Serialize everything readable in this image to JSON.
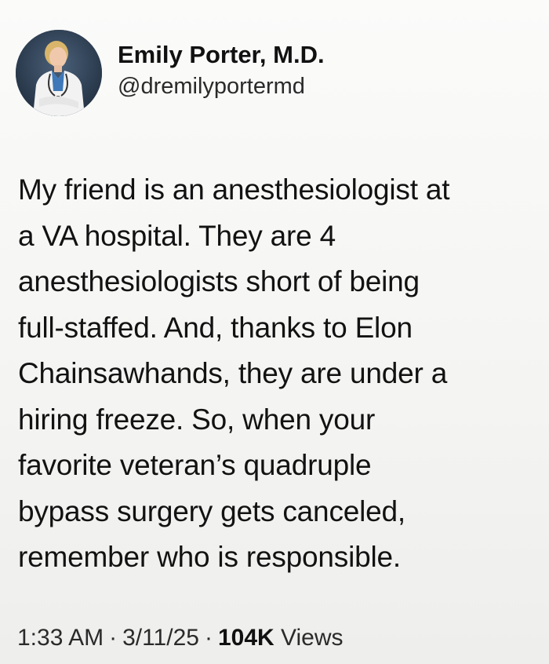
{
  "author": {
    "display_name": "Emily Porter, M.D.",
    "handle": "@dremilyportermd"
  },
  "tweet": {
    "text": "My friend is an anesthesiologist at\na VA hospital. They are 4\nanesthesiologists short of being\nfull-staffed. And, thanks to Elon\nChainsawhands, they are under a\nhiring freeze. So, when your\nfavorite veteran’s quadruple\nbypass surgery gets canceled,\nremember who is responsible."
  },
  "meta": {
    "time": "1:33 AM",
    "separator": "·",
    "date": "3/11/25",
    "views_count": "104K",
    "views_label": "Views"
  },
  "colors": {
    "background": "#f4f4f2",
    "text": "#121212",
    "avatar_bg": "#2c3e55",
    "coat": "#f2f2f2"
  }
}
